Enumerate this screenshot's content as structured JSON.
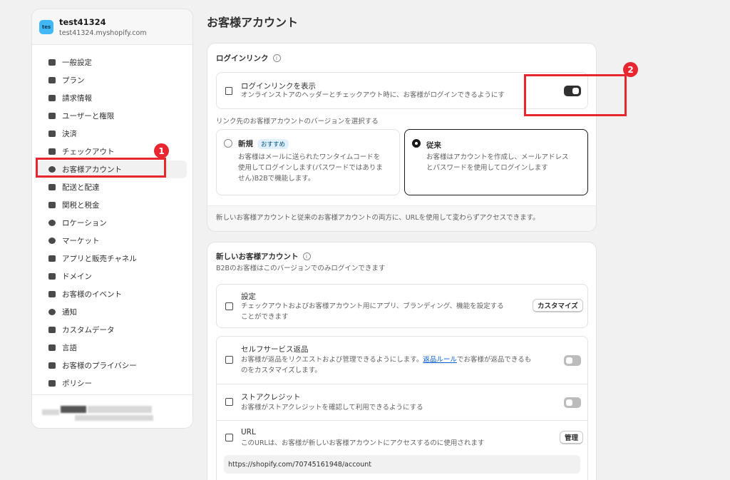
{
  "store": {
    "avatar_text": "tes",
    "name": "test41324",
    "domain": "test41324.myshopify.com"
  },
  "nav": [
    {
      "label": "一般設定",
      "icon": "store-icon"
    },
    {
      "label": "プラン",
      "icon": "chart-icon"
    },
    {
      "label": "請求情報",
      "icon": "billing-icon"
    },
    {
      "label": "ユーザーと権限",
      "icon": "users-icon"
    },
    {
      "label": "決済",
      "icon": "payments-icon"
    },
    {
      "label": "チェックアウト",
      "icon": "cart-icon"
    },
    {
      "label": "お客様アカウント",
      "icon": "person-icon"
    },
    {
      "label": "配送と配達",
      "icon": "truck-icon"
    },
    {
      "label": "関税と税金",
      "icon": "tax-icon"
    },
    {
      "label": "ロケーション",
      "icon": "location-icon"
    },
    {
      "label": "マーケット",
      "icon": "globe-icon"
    },
    {
      "label": "アプリと販売チャネル",
      "icon": "apps-icon"
    },
    {
      "label": "ドメイン",
      "icon": "domain-icon"
    },
    {
      "label": "お客様のイベント",
      "icon": "events-icon"
    },
    {
      "label": "通知",
      "icon": "bell-icon"
    },
    {
      "label": "カスタムデータ",
      "icon": "data-icon"
    },
    {
      "label": "言語",
      "icon": "language-icon"
    },
    {
      "label": "お客様のプライバシー",
      "icon": "lock-icon"
    },
    {
      "label": "ポリシー",
      "icon": "policy-icon"
    }
  ],
  "page_title": "お客様アカウント",
  "login_card": {
    "title": "ログインリンク",
    "show_link_title": "ログインリンクを表示",
    "show_link_desc": "オンラインストアのヘッダーとチェックアウト時に、お客様がログインできるようにす",
    "show_link_enabled": true,
    "version_prompt": "リンク先のお客様アカウントのバージョンを選択する",
    "new_option": {
      "title": "新規",
      "badge": "おすすめ",
      "desc": [
        "お客様はメールに送られたワンタイムコードを",
        "使用してログインします(パスワードではありま",
        "せん)B2Bで機能します。"
      ]
    },
    "classic_option": {
      "title": "従来",
      "desc": [
        "お客様はアカウントを作成し、メールアドレス",
        "とパスワードを使用してログインします"
      ]
    },
    "selected": "classic",
    "footer": "新しいお客様アカウントと従来のお客様アカウントの両方に、URLを使用して変わらずアクセスできます。"
  },
  "new_accounts_card": {
    "title": "新しいお客様アカウント",
    "subtitle": "B2Bのお客様はこのバージョンでのみログインできます",
    "settings": {
      "title": "設定",
      "desc": [
        "チェックアウトおよびお客様アカウント用にアプリ、ブランディング、機能を設定する",
        "ことができます"
      ],
      "button": "カスタマイズ"
    },
    "returns": {
      "title": "セルフサービス返品",
      "desc_before": "お客様が返品をリクエストおよび管理できるようにします。",
      "link": "返品ルール",
      "desc_after": "でお客様が返品できるも",
      "desc_line2": "のをカスタマイズします。",
      "enabled": false
    },
    "store_credit": {
      "title": "ストアクレジット",
      "desc": "お客様がストアクレジットを確認して利用できるようにする",
      "enabled": false
    },
    "url": {
      "title": "URL",
      "desc": "このURLは、お客様が新しいお客様アカウントにアクセスするのに使用されます",
      "button": "管理",
      "value": "https://shopify.com/70745161948/account"
    }
  },
  "annotations": {
    "marker1": "1",
    "marker2": "2",
    "color": "#e8262f"
  }
}
